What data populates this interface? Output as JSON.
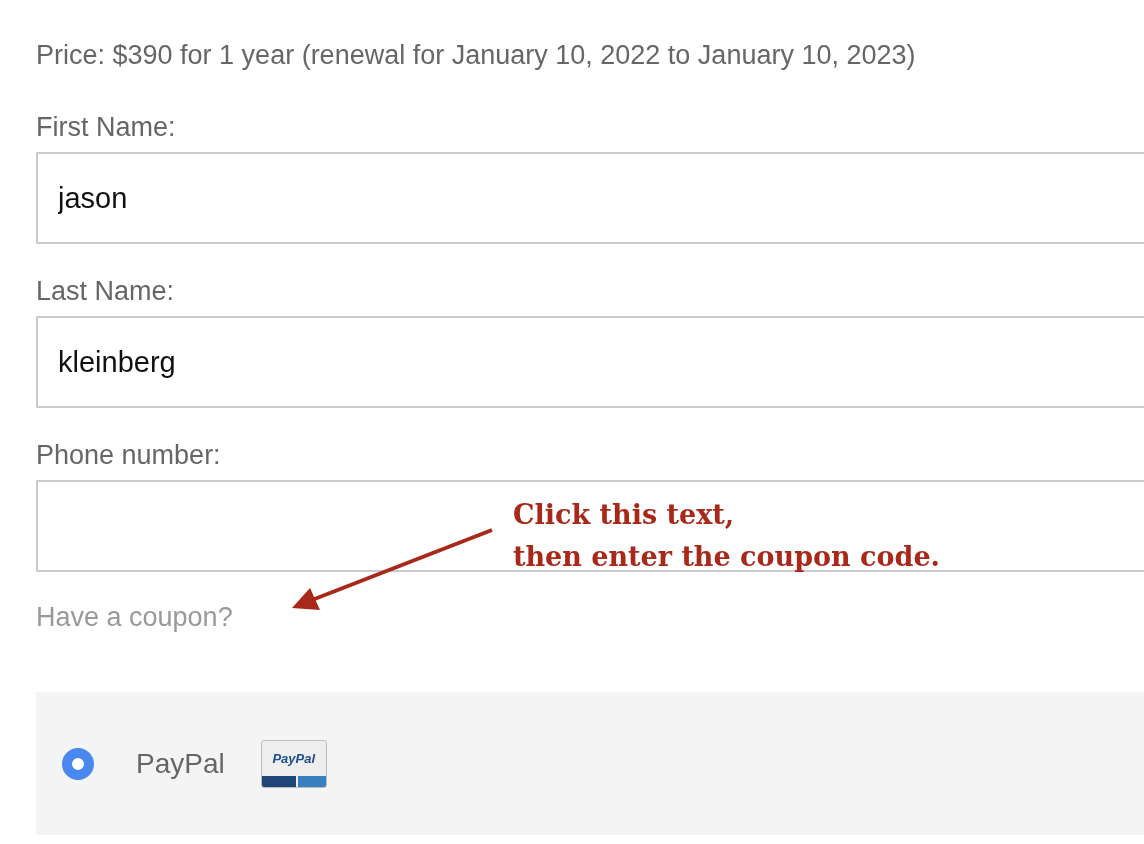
{
  "price_text": "Price: $390 for 1 year (renewal for January 10, 2022 to January 10, 2023)",
  "fields": [
    {
      "label": "First Name:",
      "value": "jason"
    },
    {
      "label": "Last Name:",
      "value": "kleinberg"
    },
    {
      "label": "Phone number:"
    }
  ],
  "coupon_link": "Have a coupon?",
  "annotation": {
    "lines": [
      "Click this text,",
      "then enter the coupon code."
    ]
  },
  "payment_methods": [
    {
      "label": "PayPal",
      "selected": true,
      "logo_text": "PayPal"
    }
  ]
}
